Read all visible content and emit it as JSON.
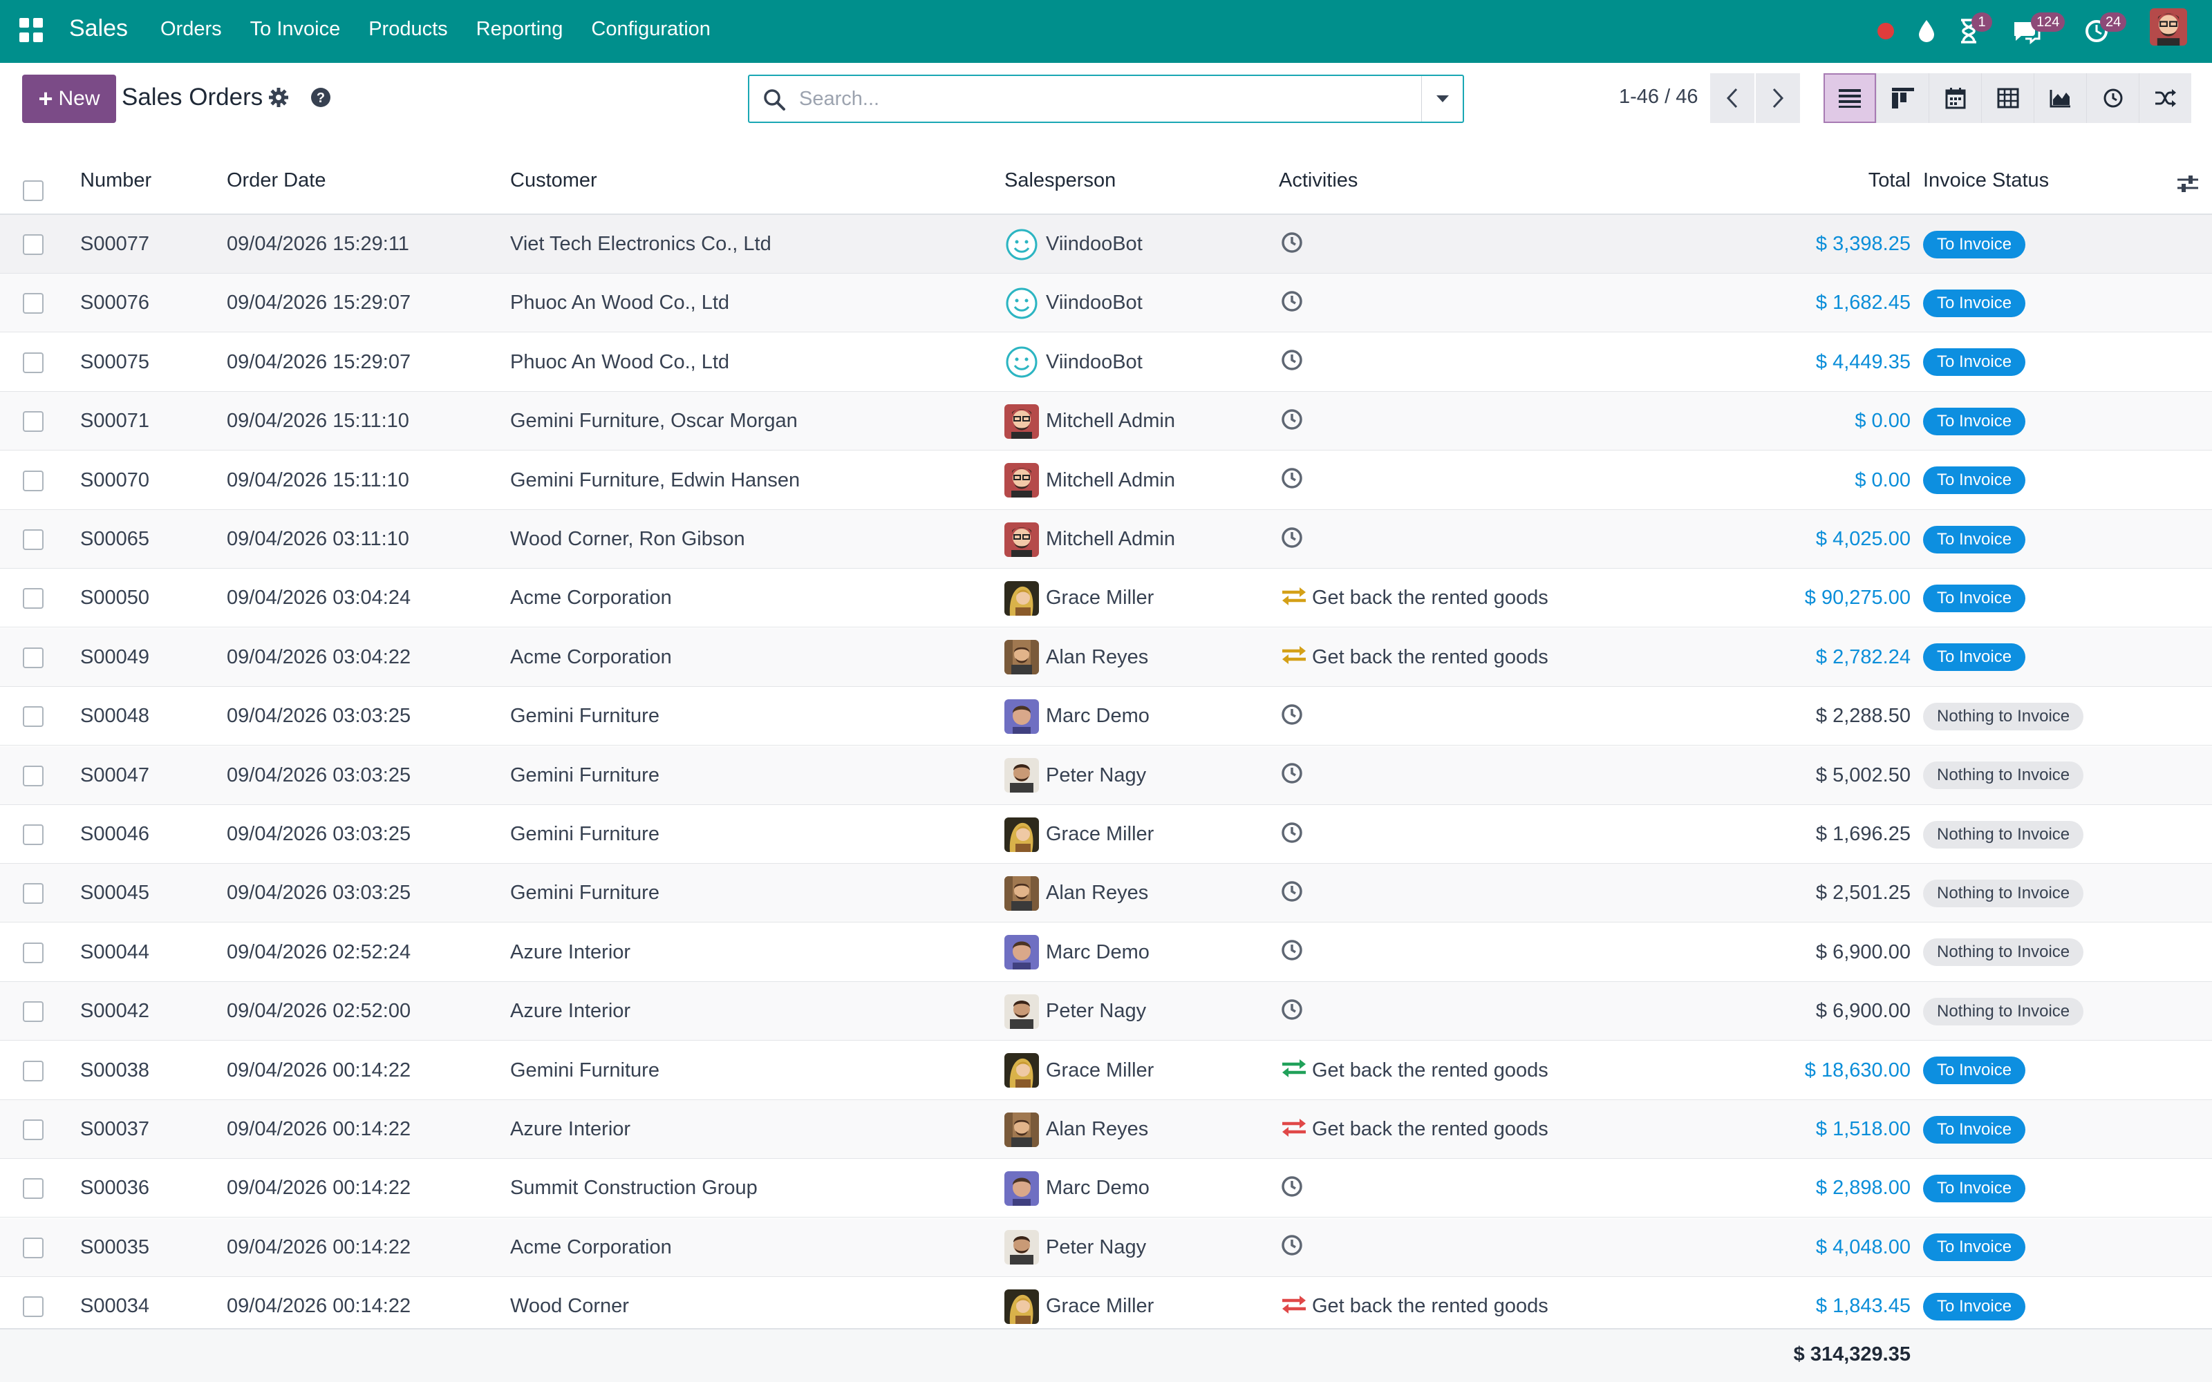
{
  "nav": {
    "app_name": "Sales",
    "menu": [
      "Orders",
      "To Invoice",
      "Products",
      "Reporting",
      "Configuration"
    ],
    "badges": {
      "activities": "1",
      "messages": "124",
      "updates": "24"
    }
  },
  "control_panel": {
    "new_label": "New",
    "title": "Sales Orders",
    "search_placeholder": "Search...",
    "pager": "1-46 / 46"
  },
  "columns": {
    "number": "Number",
    "order_date": "Order Date",
    "customer": "Customer",
    "salesperson": "Salesperson",
    "activities": "Activities",
    "total": "Total",
    "invoice_status": "Invoice Status"
  },
  "rows": [
    {
      "number": "S00077",
      "date": "09/04/2026 15:29:11",
      "customer": "Viet Tech Electronics Co., Ltd",
      "salesperson": "ViindooBot",
      "avatar": "bot",
      "activity": "",
      "activity_icon": "clock",
      "total": "$ 3,398.25",
      "status": "To Invoice"
    },
    {
      "number": "S00076",
      "date": "09/04/2026 15:29:07",
      "customer": "Phuoc An Wood Co., Ltd",
      "salesperson": "ViindooBot",
      "avatar": "bot",
      "activity": "",
      "activity_icon": "clock",
      "total": "$ 1,682.45",
      "status": "To Invoice"
    },
    {
      "number": "S00075",
      "date": "09/04/2026 15:29:07",
      "customer": "Phuoc An Wood Co., Ltd",
      "salesperson": "ViindooBot",
      "avatar": "bot",
      "activity": "",
      "activity_icon": "clock",
      "total": "$ 4,449.35",
      "status": "To Invoice"
    },
    {
      "number": "S00071",
      "date": "09/04/2026 15:11:10",
      "customer": "Gemini Furniture, Oscar Morgan",
      "salesperson": "Mitchell Admin",
      "avatar": "mitchell",
      "activity": "",
      "activity_icon": "clock",
      "total": "$ 0.00",
      "status": "To Invoice"
    },
    {
      "number": "S00070",
      "date": "09/04/2026 15:11:10",
      "customer": "Gemini Furniture, Edwin Hansen",
      "salesperson": "Mitchell Admin",
      "avatar": "mitchell",
      "activity": "",
      "activity_icon": "clock",
      "total": "$ 0.00",
      "status": "To Invoice"
    },
    {
      "number": "S00065",
      "date": "09/04/2026 03:11:10",
      "customer": "Wood Corner, Ron Gibson",
      "salesperson": "Mitchell Admin",
      "avatar": "mitchell",
      "activity": "",
      "activity_icon": "clock",
      "total": "$ 4,025.00",
      "status": "To Invoice"
    },
    {
      "number": "S00050",
      "date": "09/04/2026 03:04:24",
      "customer": "Acme Corporation",
      "salesperson": "Grace Miller",
      "avatar": "grace",
      "activity": "Get back the rented goods",
      "activity_icon": "exchange-orange",
      "total": "$ 90,275.00",
      "status": "To Invoice"
    },
    {
      "number": "S00049",
      "date": "09/04/2026 03:04:22",
      "customer": "Acme Corporation",
      "salesperson": "Alan Reyes",
      "avatar": "alan",
      "activity": "Get back the rented goods",
      "activity_icon": "exchange-orange",
      "total": "$ 2,782.24",
      "status": "To Invoice"
    },
    {
      "number": "S00048",
      "date": "09/04/2026 03:03:25",
      "customer": "Gemini Furniture",
      "salesperson": "Marc Demo",
      "avatar": "marc",
      "activity": "",
      "activity_icon": "clock",
      "total": "$ 2,288.50",
      "status": "Nothing to Invoice"
    },
    {
      "number": "S00047",
      "date": "09/04/2026 03:03:25",
      "customer": "Gemini Furniture",
      "salesperson": "Peter Nagy",
      "avatar": "peter",
      "activity": "",
      "activity_icon": "clock",
      "total": "$ 5,002.50",
      "status": "Nothing to Invoice"
    },
    {
      "number": "S00046",
      "date": "09/04/2026 03:03:25",
      "customer": "Gemini Furniture",
      "salesperson": "Grace Miller",
      "avatar": "grace",
      "activity": "",
      "activity_icon": "clock",
      "total": "$ 1,696.25",
      "status": "Nothing to Invoice"
    },
    {
      "number": "S00045",
      "date": "09/04/2026 03:03:25",
      "customer": "Gemini Furniture",
      "salesperson": "Alan Reyes",
      "avatar": "alan",
      "activity": "",
      "activity_icon": "clock",
      "total": "$ 2,501.25",
      "status": "Nothing to Invoice"
    },
    {
      "number": "S00044",
      "date": "09/04/2026 02:52:24",
      "customer": "Azure Interior",
      "salesperson": "Marc Demo",
      "avatar": "marc",
      "activity": "",
      "activity_icon": "clock",
      "total": "$ 6,900.00",
      "status": "Nothing to Invoice"
    },
    {
      "number": "S00042",
      "date": "09/04/2026 02:52:00",
      "customer": "Azure Interior",
      "salesperson": "Peter Nagy",
      "avatar": "peter",
      "activity": "",
      "activity_icon": "clock",
      "total": "$ 6,900.00",
      "status": "Nothing to Invoice"
    },
    {
      "number": "S00038",
      "date": "09/04/2026 00:14:22",
      "customer": "Gemini Furniture",
      "salesperson": "Grace Miller",
      "avatar": "grace",
      "activity": "Get back the rented goods",
      "activity_icon": "exchange-green",
      "total": "$ 18,630.00",
      "status": "To Invoice"
    },
    {
      "number": "S00037",
      "date": "09/04/2026 00:14:22",
      "customer": "Azure Interior",
      "salesperson": "Alan Reyes",
      "avatar": "alan",
      "activity": "Get back the rented goods",
      "activity_icon": "exchange-red",
      "total": "$ 1,518.00",
      "status": "To Invoice"
    },
    {
      "number": "S00036",
      "date": "09/04/2026 00:14:22",
      "customer": "Summit Construction Group",
      "salesperson": "Marc Demo",
      "avatar": "marc",
      "activity": "",
      "activity_icon": "clock",
      "total": "$ 2,898.00",
      "status": "To Invoice"
    },
    {
      "number": "S00035",
      "date": "09/04/2026 00:14:22",
      "customer": "Acme Corporation",
      "salesperson": "Peter Nagy",
      "avatar": "peter",
      "activity": "",
      "activity_icon": "clock",
      "total": "$ 4,048.00",
      "status": "To Invoice"
    },
    {
      "number": "S00034",
      "date": "09/04/2026 00:14:22",
      "customer": "Wood Corner",
      "salesperson": "Grace Miller",
      "avatar": "grace",
      "activity": "Get back the rented goods",
      "activity_icon": "exchange-red",
      "total": "$ 1,843.45",
      "status": "To Invoice"
    }
  ],
  "footer": {
    "grand_total": "$ 314,329.35"
  },
  "colors": {
    "navbar": "#008f8c",
    "primary": "#7b4b87",
    "link": "#0b8ed9",
    "to_invoice": "#0d8fe0",
    "exchange_orange": "#d4a017",
    "exchange_green": "#21a15a",
    "exchange_red": "#e04848"
  }
}
